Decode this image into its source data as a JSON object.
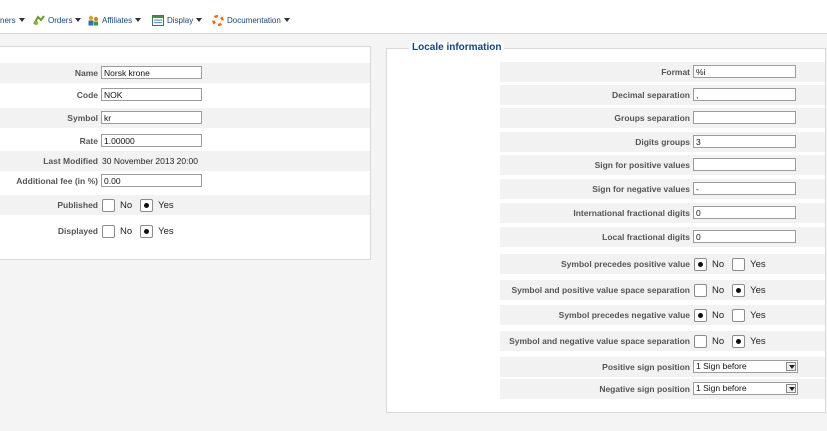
{
  "menu": {
    "items": [
      {
        "label": "ners",
        "icon": "customers-icon"
      },
      {
        "label": "Orders",
        "icon": "orders-icon"
      },
      {
        "label": "Affiliates",
        "icon": "affiliates-icon"
      },
      {
        "label": "Display",
        "icon": "display-icon"
      },
      {
        "label": "Documentation",
        "icon": "lifebuoy-icon"
      }
    ]
  },
  "currency": {
    "name_label": "Name",
    "name_value": "Norsk krone",
    "code_label": "Code",
    "code_value": "NOK",
    "symbol_label": "Symbol",
    "symbol_value": "kr",
    "rate_label": "Rate",
    "rate_value": "1.00000",
    "last_modified_label": "Last Modified",
    "last_modified_value": "30 November 2013 20:00",
    "fee_label": "Additional fee (in %)",
    "fee_value": "0.00",
    "published_label": "Published",
    "published_no": "No",
    "published_yes": "Yes",
    "published_selected": "Yes",
    "displayed_label": "Displayed",
    "displayed_no": "No",
    "displayed_yes": "Yes",
    "displayed_selected": "Yes"
  },
  "locale": {
    "legend": "Locale information",
    "format_label": "Format",
    "format_value": "%i",
    "decimal_label": "Decimal separation",
    "decimal_value": ",",
    "groups_label": "Groups separation",
    "groups_value": "",
    "digits_groups_label": "Digits groups",
    "digits_groups_value": "3",
    "sign_pos_label": "Sign for positive values",
    "sign_pos_value": "",
    "sign_neg_label": "Sign for negative values",
    "sign_neg_value": "-",
    "intl_frac_label": "International fractional digits",
    "intl_frac_value": "0",
    "local_frac_label": "Local fractional digits",
    "local_frac_value": "0",
    "radios": [
      {
        "label": "Symbol precedes positive value",
        "no": "No",
        "yes": "Yes",
        "selected": "No"
      },
      {
        "label": "Symbol and positive value space separation",
        "no": "No",
        "yes": "Yes",
        "selected": "Yes"
      },
      {
        "label": "Symbol precedes negative value",
        "no": "No",
        "yes": "Yes",
        "selected": "No"
      },
      {
        "label": "Symbol and negative value space separation",
        "no": "No",
        "yes": "Yes",
        "selected": "Yes"
      }
    ],
    "pos_sign_position_label": "Positive sign position",
    "pos_sign_position_value": "1 Sign before",
    "neg_sign_position_label": "Negative sign position",
    "neg_sign_position_value": "1 Sign before"
  }
}
